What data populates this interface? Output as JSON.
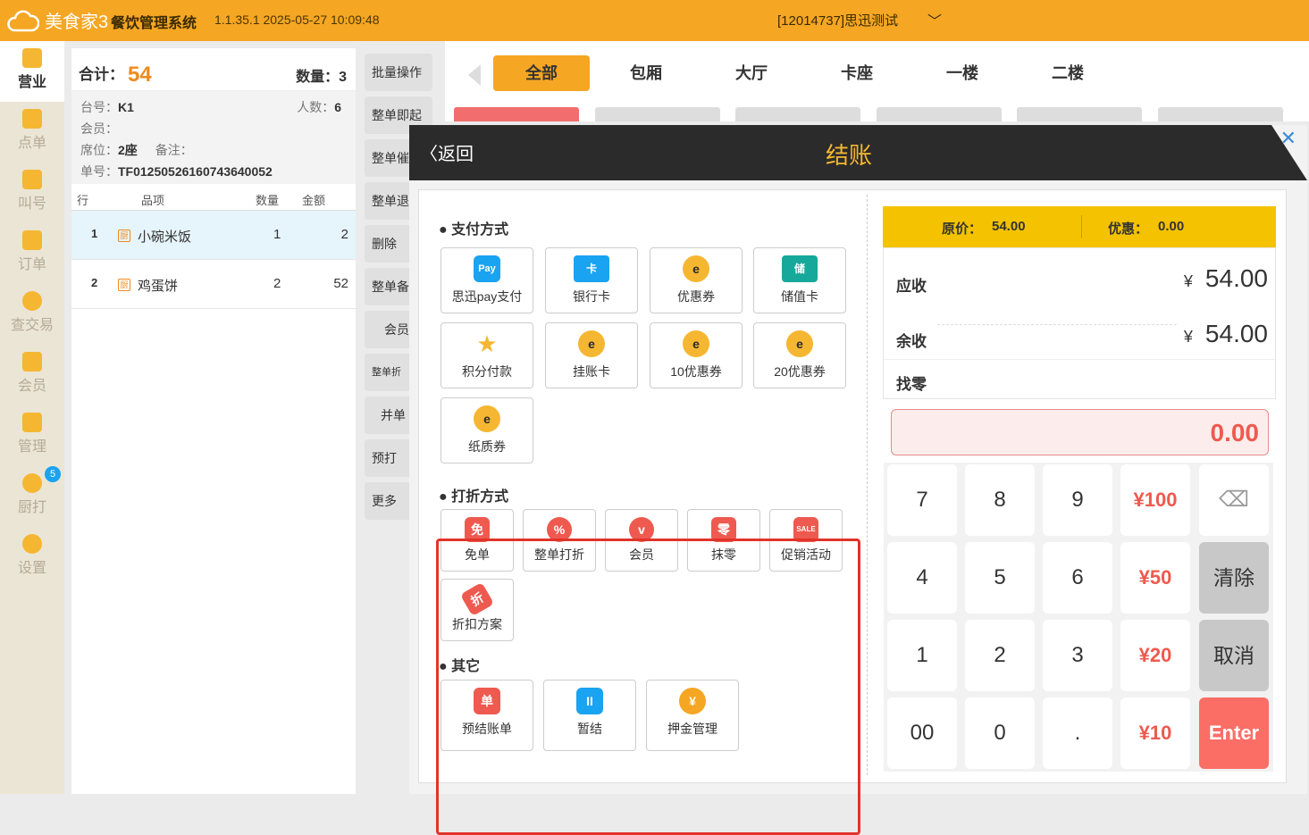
{
  "header": {
    "brand": "美食家3",
    "system_name": "餐饮管理系统",
    "version": "1.1.35.1 2025-05-27 10:09:48",
    "store": "[12014737]思迅测试"
  },
  "sidebar": {
    "items": [
      {
        "label": "营业"
      },
      {
        "label": "点单"
      },
      {
        "label": "叫号"
      },
      {
        "label": "订单"
      },
      {
        "label": "查交易"
      },
      {
        "label": "会员"
      },
      {
        "label": "管理"
      },
      {
        "label": "厨打",
        "badge": "5"
      },
      {
        "label": "设置"
      }
    ]
  },
  "order": {
    "total_label": "合计：",
    "total": "54",
    "qty_label": "数量：",
    "qty": "3",
    "table_label": "台号：",
    "table": "K1",
    "people_label": "人数：",
    "people": "6",
    "member_label": "会员：",
    "seat_label": "席位：",
    "seat": "2座",
    "note_label": "备注：",
    "bill_label": "单号：",
    "bill": "TF0125052616074364005​2",
    "columns": [
      "行",
      "品项",
      "数量",
      "金额"
    ],
    "rows": [
      {
        "line": "1",
        "icon": "厨",
        "name": "小碗米饭",
        "qty": "1",
        "amount": "2"
      },
      {
        "line": "2",
        "icon": "厨",
        "name": "鸡蛋饼",
        "qty": "2",
        "amount": "52"
      }
    ]
  },
  "ops": [
    "批量操作",
    "整单即起",
    "整单催",
    "整单退",
    "删除",
    "整单备",
    "会员",
    "整单折",
    "并单",
    "预打",
    "更多"
  ],
  "areas": [
    "全部",
    "包厢",
    "大厅",
    "卡座",
    "一楼",
    "二楼"
  ],
  "checkout": {
    "back": "返回",
    "title": "结账",
    "pay_section": "支付方式",
    "pay_methods": [
      {
        "label": "思迅pay支付",
        "icon": "Pay"
      },
      {
        "label": "银行卡",
        "icon": "卡"
      },
      {
        "label": "优惠券",
        "icon": "e"
      },
      {
        "label": "储值卡",
        "icon": "储"
      },
      {
        "label": "积分付款",
        "icon": "★"
      },
      {
        "label": "挂账卡",
        "icon": "e"
      },
      {
        "label": "10优惠券",
        "icon": "e"
      },
      {
        "label": "20优惠券",
        "icon": "e"
      },
      {
        "label": "纸质券",
        "icon": "e"
      }
    ],
    "discount_section": "打折方式",
    "discounts": [
      {
        "label": "免单",
        "icon": "免"
      },
      {
        "label": "整单打折",
        "icon": "%"
      },
      {
        "label": "会员",
        "icon": "v"
      },
      {
        "label": "抹零",
        "icon": "零"
      },
      {
        "label": "促销活动",
        "icon": "SALE"
      },
      {
        "label": "折扣方案",
        "icon": "折"
      }
    ],
    "other_section": "其它",
    "others": [
      {
        "label": "预结账单",
        "icon": "单"
      },
      {
        "label": "暂结",
        "icon": "II"
      },
      {
        "label": "押金管理",
        "icon": "¥"
      }
    ],
    "original_label": "原价：",
    "original": "54.00",
    "discount_label": "优惠：",
    "discount": "0.00",
    "receivable_label": "应收",
    "receivable": "54.00",
    "remaining_label": "余收",
    "remaining": "54.00",
    "change_label": "找零",
    "currency": "¥",
    "input_value": "0.00",
    "keys": [
      "7",
      "8",
      "9",
      "¥100",
      "⌫",
      "4",
      "5",
      "6",
      "¥50",
      "清除",
      "1",
      "2",
      "3",
      "¥20",
      "取消",
      "00",
      "0",
      ".",
      "¥10",
      "Enter"
    ]
  },
  "colors": {
    "brand": "#f5a623",
    "accent_red": "#ee5a4f",
    "highlight": "#e2342a"
  }
}
